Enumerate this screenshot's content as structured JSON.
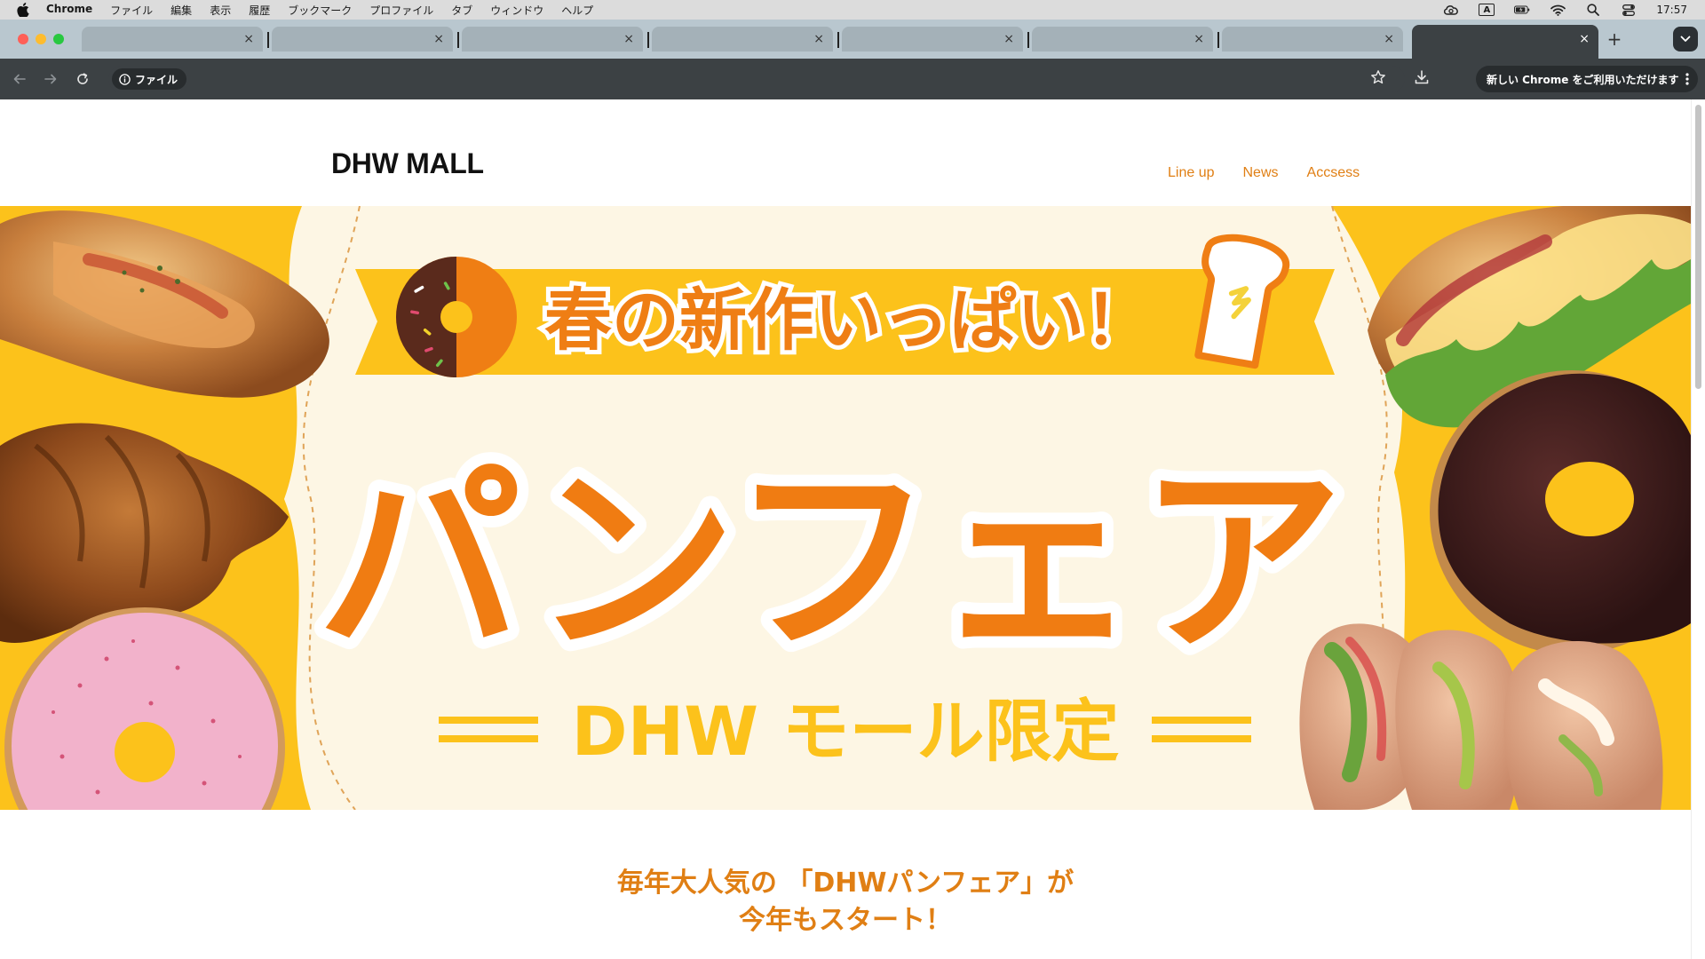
{
  "menubar": {
    "items": [
      "Chrome",
      "ファイル",
      "編集",
      "表示",
      "履歴",
      "ブックマーク",
      "プロファイル",
      "タブ",
      "ウィンドウ",
      "ヘルプ"
    ],
    "input_indicator": "A",
    "clock": "17:57"
  },
  "browser": {
    "tab_close_glyph": "×",
    "new_tab_glyph": "+",
    "site_chip_label": "ファイル",
    "update_label": "新しい Chrome をご利用いただけます",
    "colors": {
      "tabstrip": "#b9c7cf",
      "toolbar": "#3c4144",
      "inactive_tab": "#a4b1b8"
    }
  },
  "page": {
    "logo": "DHW MALL",
    "nav": [
      "Line up",
      "News",
      "Accsess"
    ],
    "hero": {
      "headline": "春の新作いっぱい！",
      "title": "パンフェア",
      "subtitle": "DHW モール限定"
    },
    "intro_line1": "毎年大人気の 「DHWパンフェア」が",
    "intro_line2": "今年もスタート！",
    "colors": {
      "accent": "#e07f14",
      "yellow": "#fcc21b",
      "cream": "#fdf6e4",
      "orange": "#f07c12"
    }
  }
}
